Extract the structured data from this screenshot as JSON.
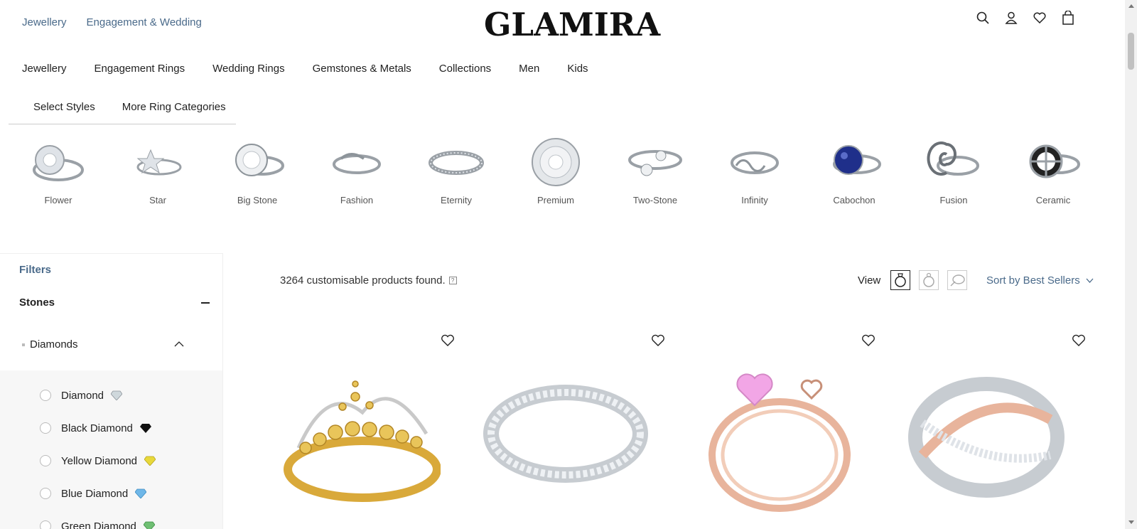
{
  "header": {
    "top_links": [
      "Jewellery",
      "Engagement & Wedding"
    ],
    "logo": "GLAMIRA"
  },
  "main_nav": [
    "Jewellery",
    "Engagement Rings",
    "Wedding Rings",
    "Gemstones & Metals",
    "Collections",
    "Men",
    "Kids"
  ],
  "sub_nav": [
    "Select Styles",
    "More Ring Categories"
  ],
  "styles": [
    "Flower",
    "Star",
    "Big Stone",
    "Fashion",
    "Eternity",
    "Premium",
    "Two-Stone",
    "Infinity",
    "Cabochon",
    "Fusion",
    "Ceramic"
  ],
  "filters": {
    "title": "Filters",
    "stones_label": "Stones",
    "diamonds_label": "Diamonds",
    "stone_options": [
      {
        "name": "Diamond",
        "color": "#cfd8dc"
      },
      {
        "name": "Black Diamond",
        "color": "#111111"
      },
      {
        "name": "Yellow Diamond",
        "color": "#e8d83a"
      },
      {
        "name": "Blue Diamond",
        "color": "#6fb7e8"
      },
      {
        "name": "Green Diamond",
        "color": "#6fbf73"
      }
    ]
  },
  "results": {
    "count_text": "3264 customisable products found.",
    "help": "?",
    "view_label": "View",
    "sort_label": "Sort by Best Sellers"
  },
  "colors": {
    "accent": "#4a6a8a",
    "gold": "#d9a93a",
    "rose_gold": "#e8b49c",
    "pink_stone": "#f2a6e6",
    "sapphire": "#1f2f8a"
  }
}
